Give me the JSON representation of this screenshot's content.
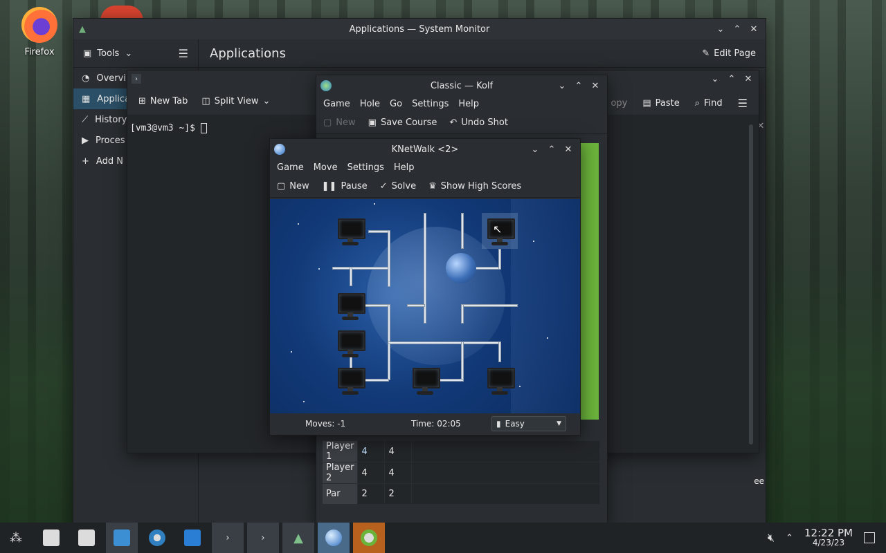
{
  "desktop": {
    "firefox_label": "Firefox"
  },
  "sysmon": {
    "title": "Applications — System Monitor",
    "tools_label": "Tools",
    "page_title": "Applications",
    "edit_page": "Edit Page",
    "sidebar": [
      {
        "label": "Overvi",
        "icon": "gauge-icon"
      },
      {
        "label": "Applica",
        "icon": "grid-icon"
      },
      {
        "label": "History",
        "icon": "chart-icon"
      },
      {
        "label": "Proces",
        "icon": "process-icon"
      },
      {
        "label": "Add N",
        "icon": "plus-icon"
      }
    ]
  },
  "konsole": {
    "new_tab": "New Tab",
    "split_view": "Split View",
    "prompt": "[vm3@vm3 ~]$ ",
    "copy": "opy",
    "paste": "Paste",
    "find": "Find"
  },
  "kolf": {
    "title": "Classic — Kolf",
    "menu": [
      "Game",
      "Hole",
      "Go",
      "Settings",
      "Help"
    ],
    "new": "New",
    "save_course": "Save Course",
    "undo_shot": "Undo Shot",
    "scores": [
      {
        "label": "Player 1",
        "a": "4",
        "b": "4"
      },
      {
        "label": "Player 2",
        "a": "4",
        "b": "4"
      },
      {
        "label": "Par",
        "a": "2",
        "b": "2"
      }
    ]
  },
  "knet": {
    "title": "KNetWalk <2>",
    "menu": [
      "Game",
      "Move",
      "Settings",
      "Help"
    ],
    "new": "New",
    "pause": "Pause",
    "solve": "Solve",
    "high_scores": "Show High Scores",
    "moves": "Moves: -1",
    "time": "Time: 02:05",
    "difficulty": "Easy"
  },
  "taskbar": {
    "time": "12:22 PM",
    "date": "4/23/23",
    "partial_label": "ee"
  }
}
